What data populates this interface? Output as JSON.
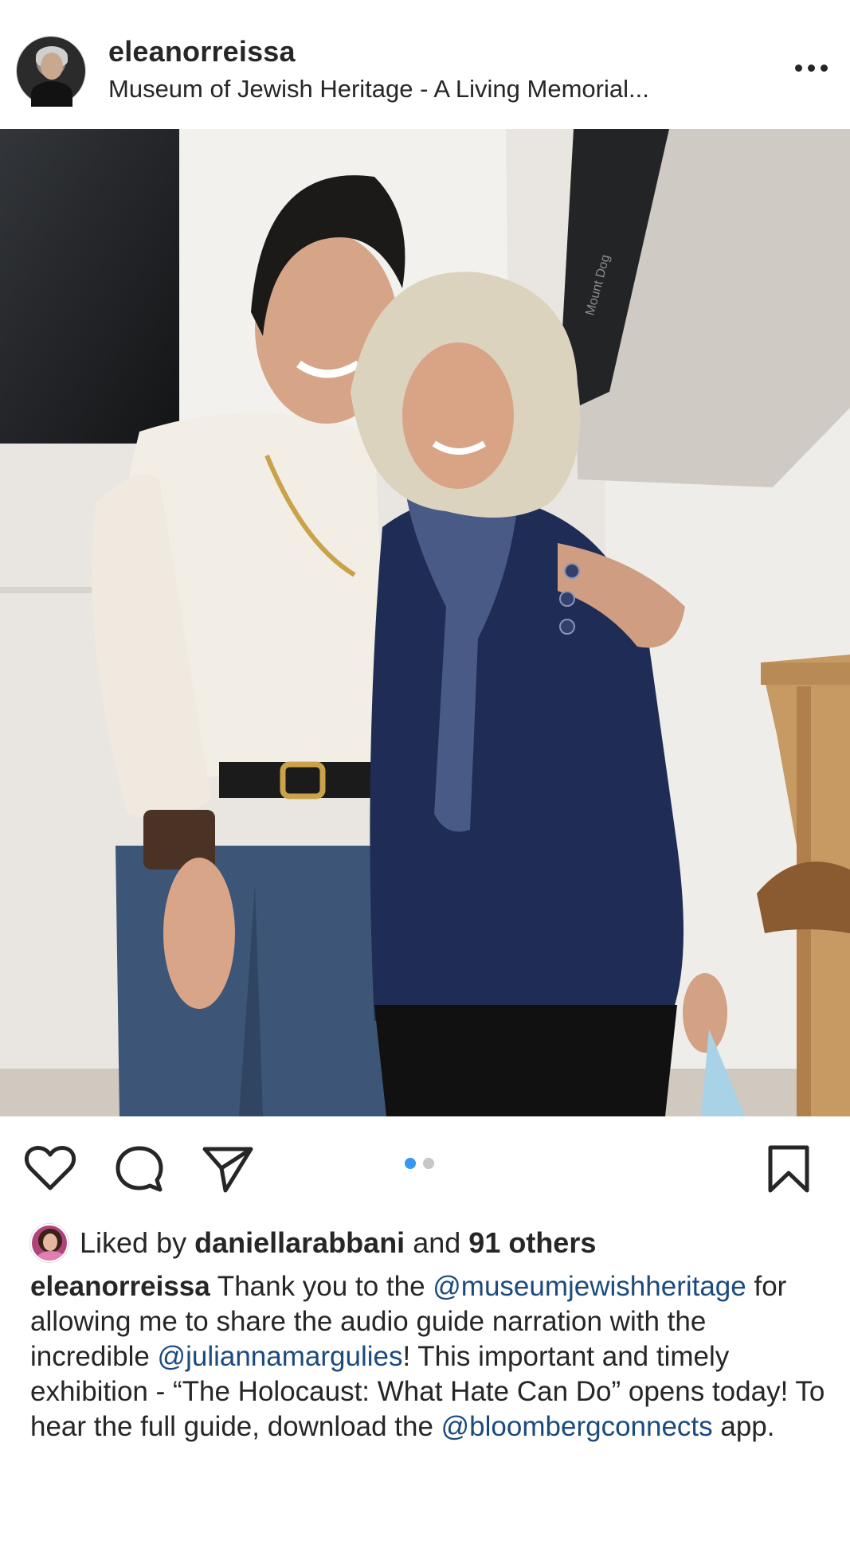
{
  "post": {
    "username": "eleanorreissa",
    "location": "Museum of Jewish Heritage - A Living Memorial...",
    "more_icon": "more-horizontal-icon"
  },
  "actions": {
    "like_icon": "heart-icon",
    "comment_icon": "comment-icon",
    "share_icon": "paper-plane-icon",
    "save_icon": "bookmark-icon",
    "carousel": {
      "total": 2,
      "active_index": 0
    }
  },
  "likes": {
    "prefix": "Liked by",
    "user": "daniellarabbani",
    "joiner": "and",
    "others": "91 others"
  },
  "caption": {
    "author": "eleanorreissa",
    "t1": " Thank you to the ",
    "m1": "@museumjewishheritage",
    "t2": " for allowing me to share the audio guide narration with the incredible ",
    "m2": "@juliannamargulies",
    "t3": "! This important and timely exhibition - “The Holocaust: What Hate Can Do” opens today! To hear the full guide, download the ",
    "m3": "@bloombergconnects",
    "t4": " app."
  },
  "photo": {
    "softbox_text": "Mount Dog"
  },
  "colors": {
    "mention": "#1c4a7d",
    "carousel_active": "#3897f0",
    "carousel_inactive": "#c7c7c7",
    "text": "#262626"
  }
}
